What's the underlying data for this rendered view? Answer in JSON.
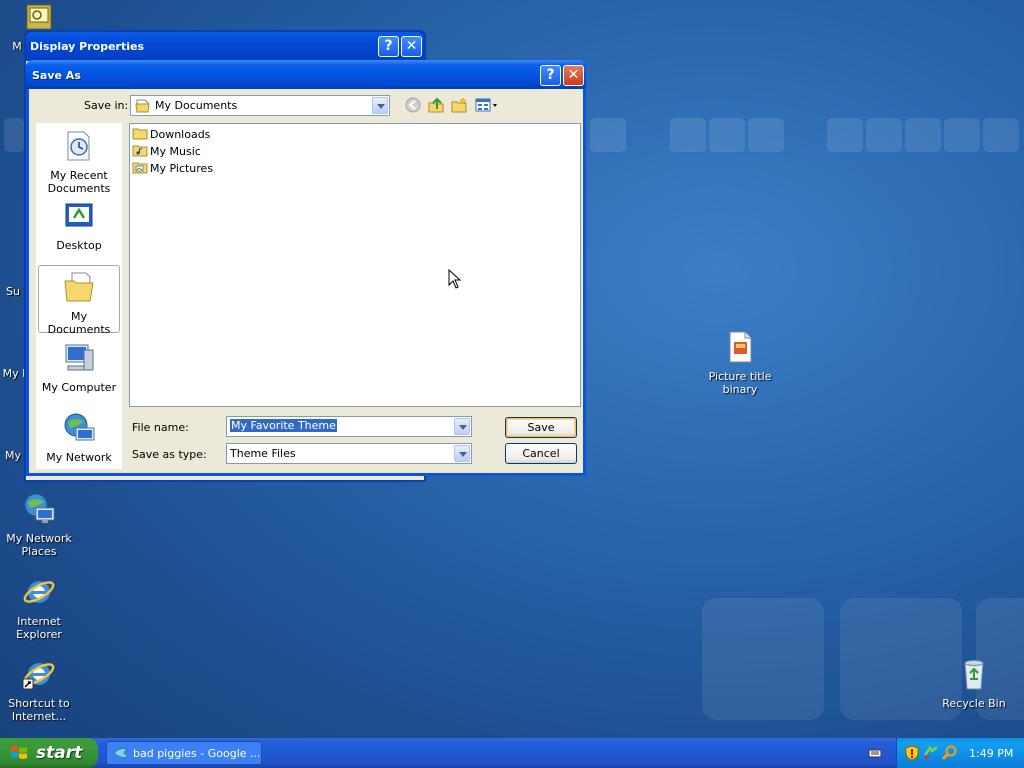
{
  "desktop": {
    "icons": [
      {
        "label": "My Network Places"
      },
      {
        "label": "Internet Explorer"
      },
      {
        "label": "Shortcut to Internet..."
      },
      {
        "label": "Picture title binary"
      },
      {
        "label": "Recycle Bin"
      }
    ],
    "partial_labels": [
      "M",
      "Su",
      "My I",
      "My"
    ]
  },
  "background_window": {
    "title": "Display Properties",
    "help_symbol": "?",
    "close_symbol": "✕"
  },
  "dialog": {
    "title": "Save As",
    "help_symbol": "?",
    "close_symbol": "✕",
    "save_in_label": "Save in:",
    "save_in_value": "My Documents",
    "places": [
      {
        "label": "My Recent Documents",
        "icon": "recent-documents-icon"
      },
      {
        "label": "Desktop",
        "icon": "desktop-icon"
      },
      {
        "label": "My Documents",
        "icon": "my-documents-icon"
      },
      {
        "label": "My Computer",
        "icon": "my-computer-icon"
      },
      {
        "label": "My Network",
        "icon": "my-network-icon"
      }
    ],
    "files": [
      {
        "name": "Downloads"
      },
      {
        "name": "My Music"
      },
      {
        "name": "My Pictures"
      }
    ],
    "file_name_label": "File name:",
    "file_name_value": "My Favorite Theme",
    "save_as_type_label": "Save as type:",
    "save_as_type_value": "Theme Files",
    "save_button": "Save",
    "cancel_button": "Cancel"
  },
  "taskbar": {
    "start_label": "start",
    "items": [
      {
        "label": "bad piggies - Google ..."
      }
    ],
    "clock": "1:49 PM"
  },
  "colors": {
    "desktop_blue": "#2a66ad",
    "title_bar_blue": "#0055e3",
    "selection_blue": "#316ac5",
    "start_green": "#3a9a3a"
  }
}
